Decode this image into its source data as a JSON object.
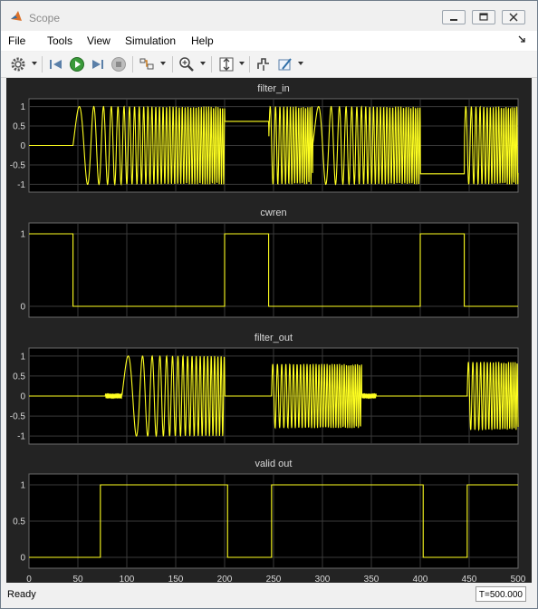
{
  "window": {
    "title": "Scope"
  },
  "menu": {
    "items": [
      "File",
      "Tools",
      "View",
      "Simulation",
      "Help"
    ]
  },
  "toolbar": {
    "icons": [
      "gear-icon",
      "step-back-icon",
      "run-icon",
      "step-forward-icon",
      "stop-icon",
      "signal-select-icon",
      "zoom-icon",
      "scale-axes-icon",
      "triggers-icon",
      "measurements-icon"
    ]
  },
  "status": {
    "text": "Ready",
    "time": "T=500.000"
  },
  "colors": {
    "background": "#232323",
    "plot_background": "#000000",
    "trace": "#ffff20",
    "grid": "#3a3a3a",
    "axis_text": "#d9d9d9"
  },
  "chart_data": [
    {
      "type": "line",
      "title": "filter_in",
      "ylim": [
        -1.2,
        1.2
      ],
      "yticks": [
        "-1",
        "-0.5",
        "0",
        "0.5",
        "1"
      ],
      "xlim": [
        0,
        500
      ],
      "xticklabels": [],
      "segments": [
        {
          "kind": "const",
          "x0": 0,
          "x1": 45,
          "y": 0
        },
        {
          "kind": "chirp",
          "x0": 45,
          "x1": 200,
          "f0": 0.03,
          "f1": 0.45,
          "amp": 1.0
        },
        {
          "kind": "const",
          "x0": 200,
          "x1": 245,
          "y": 0.62
        },
        {
          "kind": "chirp",
          "x0": 245,
          "x1": 290,
          "f0": 0.15,
          "f1": 0.5,
          "amp": 1.0
        },
        {
          "kind": "chirp",
          "x0": 290,
          "x1": 400,
          "f0": 0.03,
          "f1": 0.45,
          "amp": 1.0
        },
        {
          "kind": "const",
          "x0": 400,
          "x1": 445,
          "y": -0.73
        },
        {
          "kind": "chirp",
          "x0": 445,
          "x1": 500,
          "f0": 0.15,
          "f1": 0.5,
          "amp": 1.0
        }
      ]
    },
    {
      "type": "line",
      "title": "cwren",
      "ylim": [
        -0.15,
        1.15
      ],
      "yticks": [
        "0",
        "1"
      ],
      "xlim": [
        0,
        500
      ],
      "xticklabels": [],
      "x": [
        0,
        45,
        45,
        200,
        200,
        245,
        245,
        400,
        400,
        445,
        445,
        500
      ],
      "y": [
        1,
        1,
        0,
        0,
        1,
        1,
        0,
        0,
        1,
        1,
        0,
        0
      ]
    },
    {
      "type": "line",
      "title": "filter_out",
      "ylim": [
        -1.2,
        1.2
      ],
      "yticks": [
        "-1",
        "-0.5",
        "0",
        "0.5",
        "1"
      ],
      "xlim": [
        0,
        500
      ],
      "xticklabels": [],
      "segments": [
        {
          "kind": "const",
          "x0": 0,
          "x1": 78,
          "y": 0
        },
        {
          "kind": "ripple",
          "x0": 78,
          "x1": 95,
          "amp": 0.06
        },
        {
          "kind": "chirp",
          "x0": 95,
          "x1": 200,
          "f0": 0.03,
          "f1": 0.32,
          "amp": 1.0
        },
        {
          "kind": "const",
          "x0": 200,
          "x1": 248,
          "y": 0
        },
        {
          "kind": "chirp",
          "x0": 248,
          "x1": 340,
          "f0": 0.2,
          "f1": 0.48,
          "amp": 0.8
        },
        {
          "kind": "ripple",
          "x0": 340,
          "x1": 355,
          "amp": 0.06
        },
        {
          "kind": "const",
          "x0": 355,
          "x1": 448,
          "y": 0
        },
        {
          "kind": "chirp",
          "x0": 448,
          "x1": 500,
          "f0": 0.2,
          "f1": 0.48,
          "amp": 0.85
        }
      ]
    },
    {
      "type": "line",
      "title": "valid out",
      "ylim": [
        -0.15,
        1.15
      ],
      "yticks": [
        "0",
        "0.5",
        "1"
      ],
      "xlim": [
        0,
        500
      ],
      "xticklabels": [
        "0",
        "50",
        "100",
        "150",
        "200",
        "250",
        "300",
        "350",
        "400",
        "450",
        "500"
      ],
      "x": [
        0,
        73,
        73,
        203,
        203,
        248,
        248,
        403,
        403,
        448,
        448,
        500
      ],
      "y": [
        0,
        0,
        1,
        1,
        0,
        0,
        1,
        1,
        0,
        0,
        1,
        1
      ]
    }
  ]
}
